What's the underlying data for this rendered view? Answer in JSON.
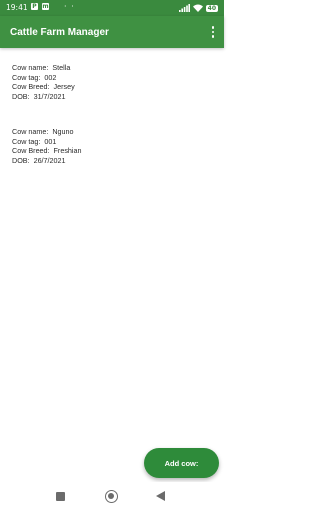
{
  "status_bar": {
    "time": "19:41",
    "notification_icons": [
      "P",
      "m"
    ],
    "dots": "· ·",
    "battery": "40"
  },
  "app_bar": {
    "title": "Cattle Farm Manager",
    "menu_icon": "more-vert-icon"
  },
  "cows": [
    {
      "name_label": "Cow name:  Stella",
      "tag_label": "Cow tag:  002",
      "breed_label": "Cow Breed:  Jersey",
      "dob_label": "DOB:  31/7/2021"
    },
    {
      "name_label": "Cow name:  Nguno",
      "tag_label": "Cow tag:  001",
      "breed_label": "Cow Breed:  Freshian",
      "dob_label": "DOB:  26/7/2021"
    }
  ],
  "fab": {
    "label": "Add cow:"
  },
  "nav": {
    "icons": [
      "recents-icon",
      "home-icon",
      "back-icon"
    ]
  },
  "colors": {
    "primary": "#3f9142",
    "status": "#3a8a3e",
    "fab": "#2e8b3a"
  }
}
